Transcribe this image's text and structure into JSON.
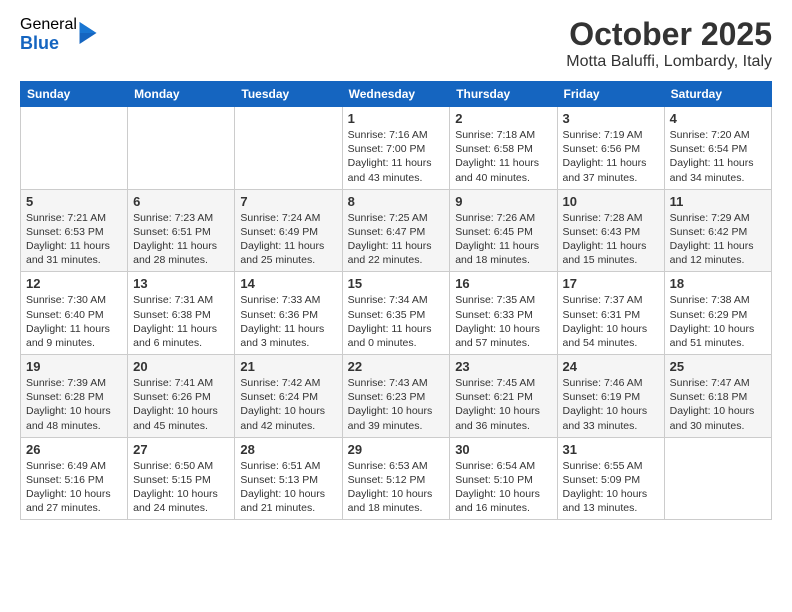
{
  "logo": {
    "general": "General",
    "blue": "Blue"
  },
  "header": {
    "month": "October 2025",
    "location": "Motta Baluffi, Lombardy, Italy"
  },
  "weekdays": [
    "Sunday",
    "Monday",
    "Tuesday",
    "Wednesday",
    "Thursday",
    "Friday",
    "Saturday"
  ],
  "weeks": [
    [
      {
        "day": "",
        "info": ""
      },
      {
        "day": "",
        "info": ""
      },
      {
        "day": "",
        "info": ""
      },
      {
        "day": "1",
        "info": "Sunrise: 7:16 AM\nSunset: 7:00 PM\nDaylight: 11 hours and 43 minutes."
      },
      {
        "day": "2",
        "info": "Sunrise: 7:18 AM\nSunset: 6:58 PM\nDaylight: 11 hours and 40 minutes."
      },
      {
        "day": "3",
        "info": "Sunrise: 7:19 AM\nSunset: 6:56 PM\nDaylight: 11 hours and 37 minutes."
      },
      {
        "day": "4",
        "info": "Sunrise: 7:20 AM\nSunset: 6:54 PM\nDaylight: 11 hours and 34 minutes."
      }
    ],
    [
      {
        "day": "5",
        "info": "Sunrise: 7:21 AM\nSunset: 6:53 PM\nDaylight: 11 hours and 31 minutes."
      },
      {
        "day": "6",
        "info": "Sunrise: 7:23 AM\nSunset: 6:51 PM\nDaylight: 11 hours and 28 minutes."
      },
      {
        "day": "7",
        "info": "Sunrise: 7:24 AM\nSunset: 6:49 PM\nDaylight: 11 hours and 25 minutes."
      },
      {
        "day": "8",
        "info": "Sunrise: 7:25 AM\nSunset: 6:47 PM\nDaylight: 11 hours and 22 minutes."
      },
      {
        "day": "9",
        "info": "Sunrise: 7:26 AM\nSunset: 6:45 PM\nDaylight: 11 hours and 18 minutes."
      },
      {
        "day": "10",
        "info": "Sunrise: 7:28 AM\nSunset: 6:43 PM\nDaylight: 11 hours and 15 minutes."
      },
      {
        "day": "11",
        "info": "Sunrise: 7:29 AM\nSunset: 6:42 PM\nDaylight: 11 hours and 12 minutes."
      }
    ],
    [
      {
        "day": "12",
        "info": "Sunrise: 7:30 AM\nSunset: 6:40 PM\nDaylight: 11 hours and 9 minutes."
      },
      {
        "day": "13",
        "info": "Sunrise: 7:31 AM\nSunset: 6:38 PM\nDaylight: 11 hours and 6 minutes."
      },
      {
        "day": "14",
        "info": "Sunrise: 7:33 AM\nSunset: 6:36 PM\nDaylight: 11 hours and 3 minutes."
      },
      {
        "day": "15",
        "info": "Sunrise: 7:34 AM\nSunset: 6:35 PM\nDaylight: 11 hours and 0 minutes."
      },
      {
        "day": "16",
        "info": "Sunrise: 7:35 AM\nSunset: 6:33 PM\nDaylight: 10 hours and 57 minutes."
      },
      {
        "day": "17",
        "info": "Sunrise: 7:37 AM\nSunset: 6:31 PM\nDaylight: 10 hours and 54 minutes."
      },
      {
        "day": "18",
        "info": "Sunrise: 7:38 AM\nSunset: 6:29 PM\nDaylight: 10 hours and 51 minutes."
      }
    ],
    [
      {
        "day": "19",
        "info": "Sunrise: 7:39 AM\nSunset: 6:28 PM\nDaylight: 10 hours and 48 minutes."
      },
      {
        "day": "20",
        "info": "Sunrise: 7:41 AM\nSunset: 6:26 PM\nDaylight: 10 hours and 45 minutes."
      },
      {
        "day": "21",
        "info": "Sunrise: 7:42 AM\nSunset: 6:24 PM\nDaylight: 10 hours and 42 minutes."
      },
      {
        "day": "22",
        "info": "Sunrise: 7:43 AM\nSunset: 6:23 PM\nDaylight: 10 hours and 39 minutes."
      },
      {
        "day": "23",
        "info": "Sunrise: 7:45 AM\nSunset: 6:21 PM\nDaylight: 10 hours and 36 minutes."
      },
      {
        "day": "24",
        "info": "Sunrise: 7:46 AM\nSunset: 6:19 PM\nDaylight: 10 hours and 33 minutes."
      },
      {
        "day": "25",
        "info": "Sunrise: 7:47 AM\nSunset: 6:18 PM\nDaylight: 10 hours and 30 minutes."
      }
    ],
    [
      {
        "day": "26",
        "info": "Sunrise: 6:49 AM\nSunset: 5:16 PM\nDaylight: 10 hours and 27 minutes."
      },
      {
        "day": "27",
        "info": "Sunrise: 6:50 AM\nSunset: 5:15 PM\nDaylight: 10 hours and 24 minutes."
      },
      {
        "day": "28",
        "info": "Sunrise: 6:51 AM\nSunset: 5:13 PM\nDaylight: 10 hours and 21 minutes."
      },
      {
        "day": "29",
        "info": "Sunrise: 6:53 AM\nSunset: 5:12 PM\nDaylight: 10 hours and 18 minutes."
      },
      {
        "day": "30",
        "info": "Sunrise: 6:54 AM\nSunset: 5:10 PM\nDaylight: 10 hours and 16 minutes."
      },
      {
        "day": "31",
        "info": "Sunrise: 6:55 AM\nSunset: 5:09 PM\nDaylight: 10 hours and 13 minutes."
      },
      {
        "day": "",
        "info": ""
      }
    ]
  ]
}
